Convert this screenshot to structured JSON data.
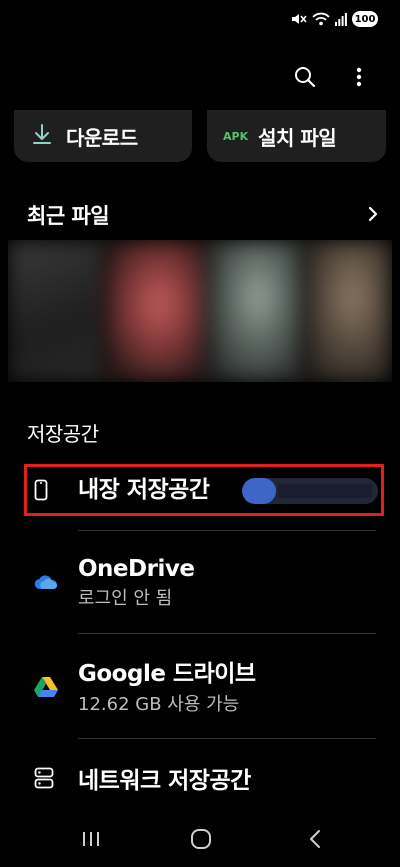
{
  "status_bar": {
    "battery": "100",
    "icons": [
      "mute-icon",
      "wifi-icon",
      "signal-icon"
    ]
  },
  "app_bar": {
    "actions": [
      "search-icon",
      "more-vert-icon"
    ]
  },
  "categories": [
    {
      "label": "다운로드",
      "icon": "download-icon"
    },
    {
      "label": "설치 파일",
      "badge": "APK"
    }
  ],
  "recent": {
    "title": "최근 파일",
    "thumbnails": [
      "thumb-1",
      "thumb-2",
      "thumb-3",
      "thumb-4"
    ]
  },
  "storage": {
    "title": "저장공간",
    "items": [
      {
        "title": "내장 저장공간",
        "icon": "phone-icon",
        "usage_fraction": 0.25
      },
      {
        "title": "OneDrive",
        "subtitle": "로그인 안 됨",
        "icon": "onedrive-icon"
      },
      {
        "title": "Google 드라이브",
        "subtitle": "12.62 GB 사용 가능",
        "icon": "google-drive-icon"
      },
      {
        "title": "네트워크 저장공간",
        "icon": "network-storage-icon"
      }
    ]
  },
  "colors": {
    "background": "#000000",
    "card": "#1f1f1f",
    "accent_blue": "#3d66c8",
    "highlight_red": "#e0201f",
    "apk_green": "#56c26f"
  }
}
